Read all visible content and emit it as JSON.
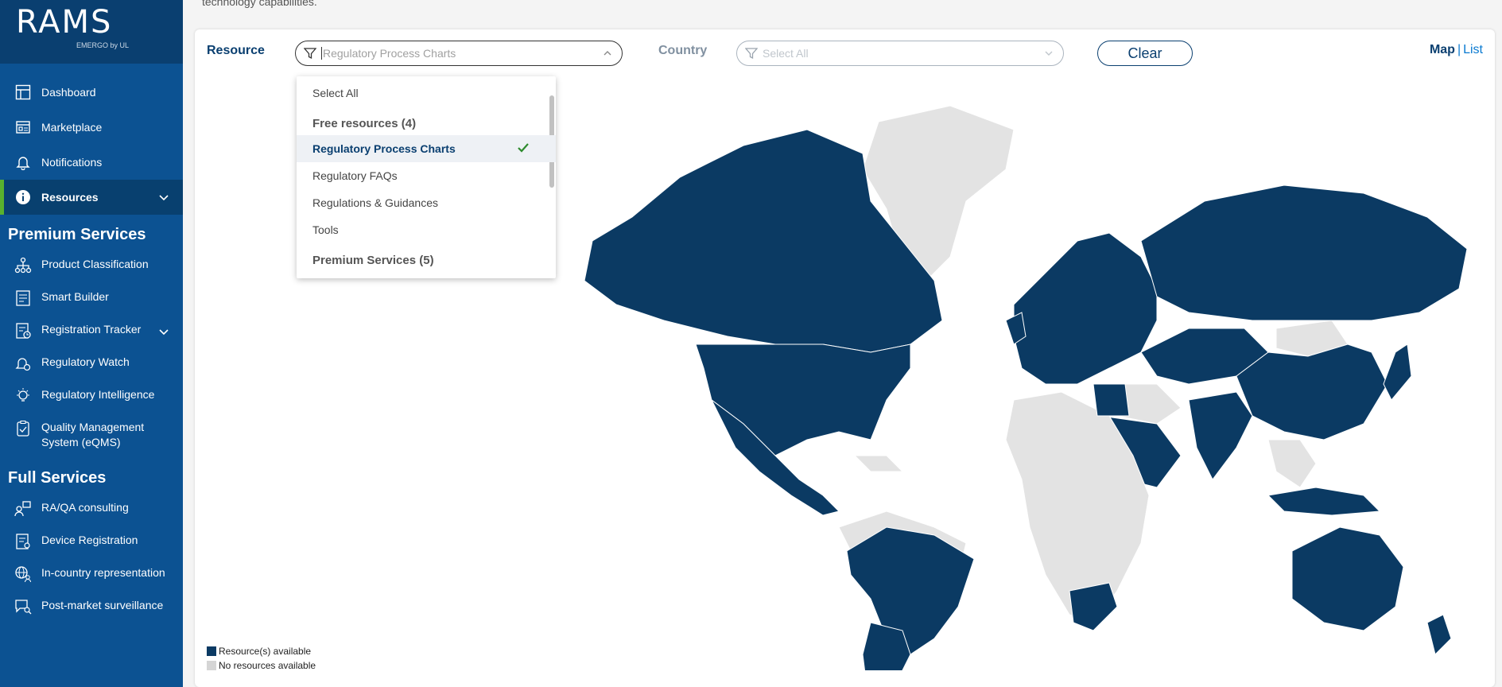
{
  "brand": {
    "logo_text": "RAMS",
    "logo_sub": "EMERGO by UL"
  },
  "top_text": "technology capabilities.",
  "sidebar": {
    "nav": [
      {
        "label": "Dashboard",
        "icon": "dashboard-icon"
      },
      {
        "label": "Marketplace",
        "icon": "marketplace-icon"
      },
      {
        "label": "Notifications",
        "icon": "bell-icon"
      },
      {
        "label": "Resources",
        "icon": "info-icon",
        "active": true
      }
    ],
    "premium_title": "Premium Services",
    "premium": [
      {
        "label": "Product Classification",
        "icon": "hierarchy-icon"
      },
      {
        "label": "Smart Builder",
        "icon": "document-list-icon"
      },
      {
        "label": "Registration Tracker",
        "icon": "tracker-icon"
      },
      {
        "label": "Regulatory Watch",
        "icon": "watch-bell-icon"
      },
      {
        "label": "Regulatory Intelligence",
        "icon": "lightbulb-icon"
      },
      {
        "label": "Quality Management System (eQMS)",
        "icon": "clipboard-icon"
      }
    ],
    "full_title": "Full Services",
    "full": [
      {
        "label": "RA/QA consulting",
        "icon": "consulting-icon"
      },
      {
        "label": "Device Registration",
        "icon": "certificate-icon"
      },
      {
        "label": "In-country representation",
        "icon": "globe-person-icon"
      },
      {
        "label": "Post-market surveillance",
        "icon": "chat-search-icon"
      }
    ]
  },
  "filters": {
    "resource_label": "Resource",
    "resource_placeholder": "Regulatory Process Charts",
    "country_label": "Country",
    "country_placeholder": "Select All",
    "clear_label": "Clear"
  },
  "view_toggle": {
    "map": "Map",
    "sep": "|",
    "list": "List"
  },
  "dropdown": {
    "select_all": "Select All",
    "free_group": "Free resources (4)",
    "free_items": [
      "Regulatory Process Charts",
      "Regulatory FAQs",
      "Regulations & Guidances",
      "Tools"
    ],
    "selected_item": "Regulatory Process Charts",
    "premium_group": "Premium Services (5)"
  },
  "legend": {
    "available": "Resource(s) available",
    "unavailable": "No resources available"
  },
  "colors": {
    "available": "#0b3a63",
    "unavailable": "#e3e3e3",
    "sidebar": "#0c5292",
    "accent_green": "#58b12e"
  }
}
